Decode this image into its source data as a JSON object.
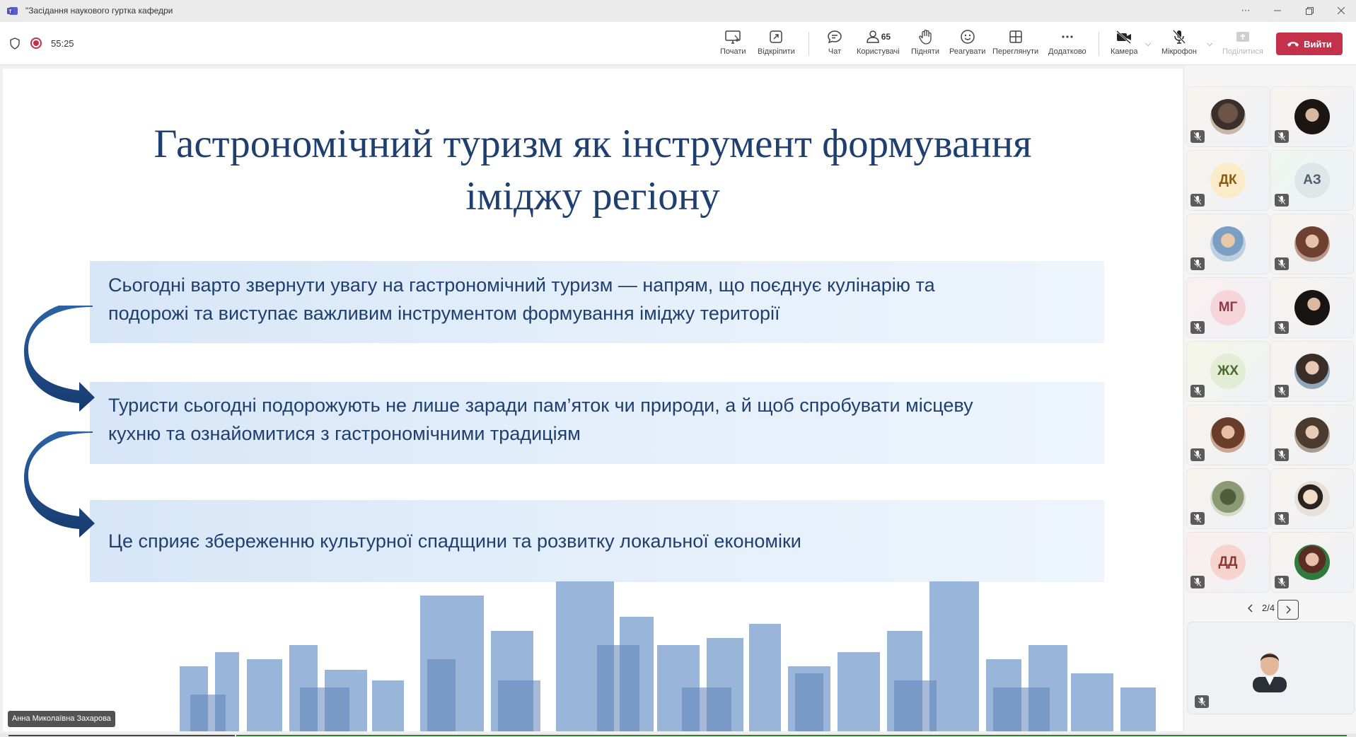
{
  "window": {
    "title": "\"Засідання наукового гуртка кафедри",
    "controls": [
      "more-icon",
      "minimize-icon",
      "restore-icon",
      "close-icon"
    ]
  },
  "toolbar": {
    "timer": "55:25",
    "buttons": {
      "start": "Почати",
      "popout": "Відкріпити",
      "chat": "Чат",
      "people": "Користувачі",
      "people_count": "65",
      "raise": "Підняти",
      "react": "Реагувати",
      "view": "Переглянути",
      "more": "Додатково",
      "camera": "Камера",
      "mic": "Мікрофон",
      "share": "Поділитися"
    },
    "leave_label": "Вийти",
    "leave_color": "#c4314b"
  },
  "slide": {
    "title_line1": "Гастрономічний туризм як інструмент формування",
    "title_line2": "іміджу регіону",
    "box1_line1": "Сьогодні варто звернути увагу на гастрономічний туризм — напрям, що поєднує кулінарію та",
    "box1_line2": "подорожі та виступає важливим інструментом формування іміджу території",
    "box2_line1": "Туристи сьогодні подорожують не лише заради пам’яток чи природи, а й щоб спробувати місцеву",
    "box2_line2": "кухню та ознайомитися з гастрономічними традиціям",
    "box3": "Це сприяє збереженню культурної спадщини та розвитку локальної економіки",
    "title_color": "#1f3f6e"
  },
  "presenter": {
    "name": "Анна Миколаївна Захарова"
  },
  "gallery": {
    "initials": {
      "dk": "ДК",
      "az": "АЗ",
      "mg": "МГ",
      "zh": "ЖХ",
      "dd": "ДД"
    },
    "page": "2/4"
  }
}
